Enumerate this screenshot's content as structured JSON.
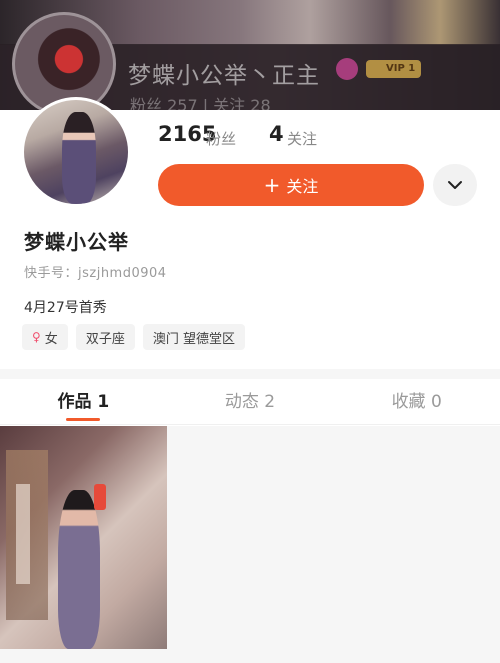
{
  "banner": {
    "name": "梦蝶小公举丶正主",
    "vip": "VIP 1",
    "stats": "粉丝 257 | 关注 28"
  },
  "profile": {
    "followers_count": "2165",
    "followers_label": "粉丝",
    "following_count": "4",
    "following_label": "关注",
    "follow_button": "关注",
    "name": "梦蝶小公举",
    "kuaishou_id": "快手号：jszjhmd0904",
    "first_post": "4月27号首秀",
    "tags": {
      "gender": "女",
      "zodiac": "双子座",
      "location": "澳门 望德堂区"
    }
  },
  "tabs": [
    {
      "label": "作品 1",
      "active": true
    },
    {
      "label": "动态 2",
      "active": false
    },
    {
      "label": "收藏 0",
      "active": false
    }
  ],
  "colors": {
    "accent": "#f15a2b",
    "female": "#f0506e"
  },
  "icons": {
    "plus": "plus-icon",
    "more": "chevron-down-icon",
    "female": "female-icon"
  }
}
